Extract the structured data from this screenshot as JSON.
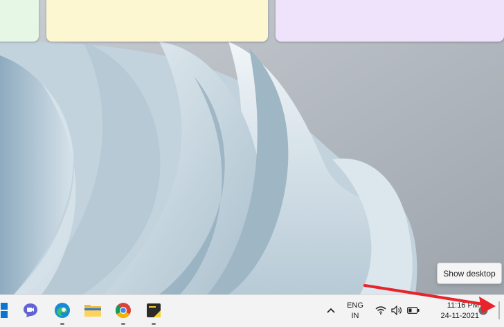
{
  "tooltip": {
    "text": "Show desktop"
  },
  "taskbar": {
    "pinned_icons": [
      "start-icon",
      "teams-chat-icon",
      "edge-icon",
      "file-explorer-icon",
      "chrome-icon",
      "sticky-notes-icon"
    ]
  },
  "tray": {
    "lang_primary": "ENG",
    "lang_secondary": "IN",
    "time": "11:16 PM",
    "date": "24-11-2021"
  },
  "colors": {
    "annotation_arrow": "#e8232a",
    "note_green": "#e6f7e6",
    "note_yellow": "#fdf7d1",
    "note_purple": "#efe3fb"
  }
}
